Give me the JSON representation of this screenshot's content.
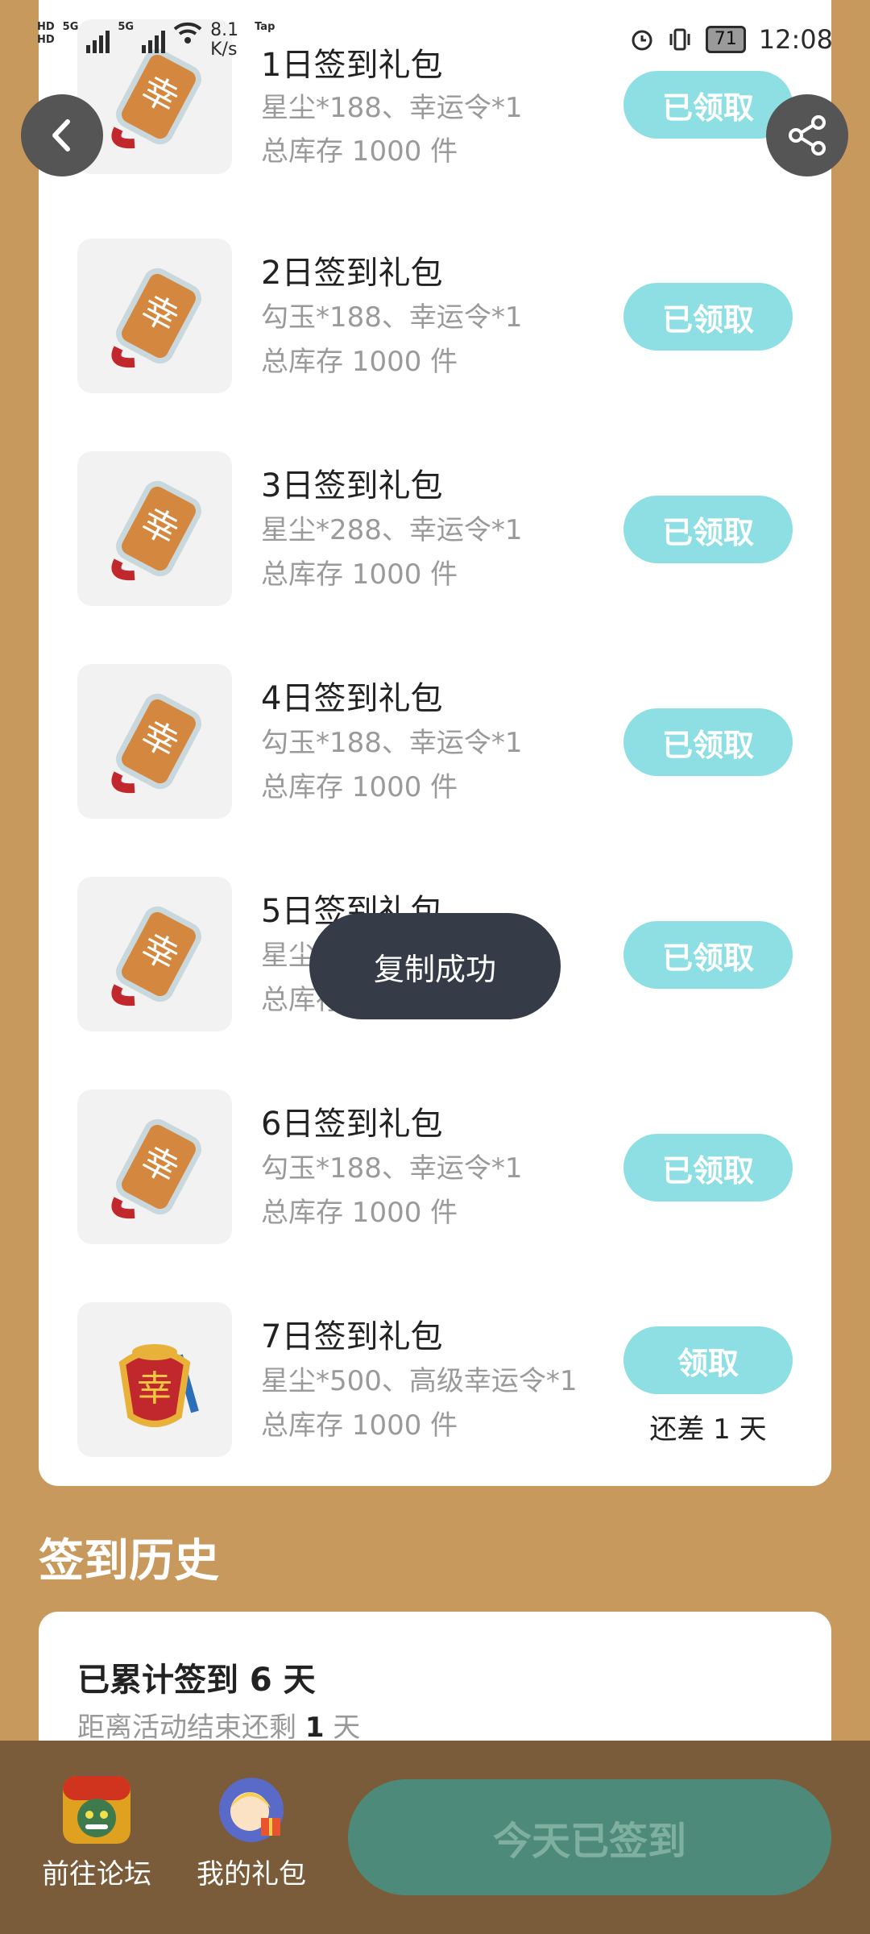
{
  "status_bar": {
    "network_tags": [
      "HD",
      "HD"
    ],
    "signal_labels": [
      "5G",
      "5G"
    ],
    "speed": "8.1",
    "speed_unit": "K/s",
    "app_hint": "Tap",
    "battery": "71",
    "time": "12:08"
  },
  "gifts": [
    {
      "title": "1日签到礼包",
      "desc": "星尘*188、幸运令*1",
      "stock": "总库存 1000 件",
      "button": "已领取"
    },
    {
      "title": "2日签到礼包",
      "desc": "勾玉*188、幸运令*1",
      "stock": "总库存 1000 件",
      "button": "已领取"
    },
    {
      "title": "3日签到礼包",
      "desc": "星尘*288、幸运令*1",
      "stock": "总库存 1000 件",
      "button": "已领取"
    },
    {
      "title": "4日签到礼包",
      "desc": "勾玉*188、幸运令*1",
      "stock": "总库存 1000 件",
      "button": "已领取"
    },
    {
      "title": "5日签到礼包",
      "desc": "星尘*388、幸运令*1",
      "stock": "总库存 1000 件",
      "button": "已领取"
    },
    {
      "title": "6日签到礼包",
      "desc": "勾玉*188、幸运令*1",
      "stock": "总库存 1000 件",
      "button": "已领取"
    },
    {
      "title": "7日签到礼包",
      "desc": "星尘*500、高级幸运令*1",
      "stock": "总库存 1000 件",
      "button": "领取",
      "remain": "还差 1 天"
    }
  ],
  "toast": "复制成功",
  "history": {
    "title": "签到历史",
    "total": "已累计签到 6 天",
    "remain_prefix": "距离活动结束还剩 ",
    "remain_value": "1",
    "remain_suffix": " 天"
  },
  "bottom": {
    "forum_label": "前往论坛",
    "gifts_label": "我的礼包",
    "signed_label": "今天已签到"
  },
  "colors": {
    "page_bg": "#C8995C",
    "claim_button": "#8EDFE3",
    "toast_bg": "#353b47",
    "bottom_bar": "#7A5C3A",
    "signed_button": "#4E8A79"
  },
  "icons": {
    "back": "chevron-left-icon",
    "share": "share-icon",
    "gift": "lucky-charm-icon"
  }
}
